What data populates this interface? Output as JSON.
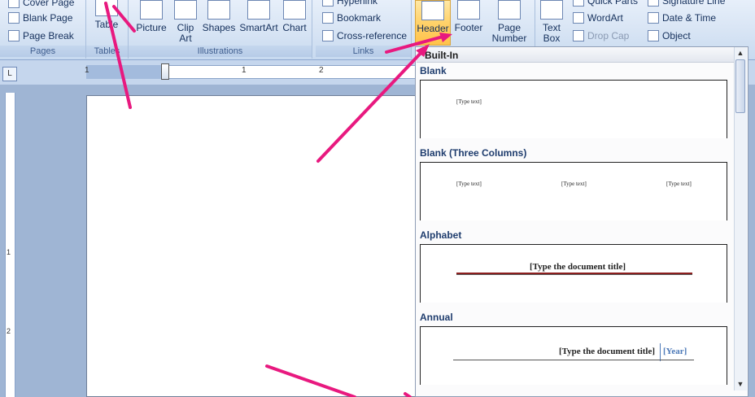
{
  "ribbon": {
    "pages_group": {
      "label": "Pages",
      "cover_page": "Cover Page",
      "blank_page": "Blank Page",
      "page_break": "Page Break"
    },
    "tables_group": {
      "label": "Tables",
      "table": "Table"
    },
    "illustrations_group": {
      "label": "Illustrations",
      "picture": "Picture",
      "clip_art": "Clip Art",
      "shapes": "Shapes",
      "smartart": "SmartArt",
      "chart": "Chart"
    },
    "links_group": {
      "label": "Links",
      "hyperlink": "Hyperlink",
      "bookmark": "Bookmark",
      "cross_reference": "Cross-reference"
    },
    "header_footer_group": {
      "header": "Header",
      "footer": "Footer",
      "page_number": "Page Number"
    },
    "text_group": {
      "text_box": "Text Box",
      "quick_parts": "Quick Parts",
      "wordart": "WordArt",
      "drop_cap": "Drop Cap",
      "signature_line": "Signature Line",
      "date_time": "Date & Time",
      "object": "Object"
    }
  },
  "ruler": {
    "numbers": [
      "1",
      "1",
      "2"
    ]
  },
  "vertical_ruler": {
    "numbers": [
      "1",
      "2"
    ]
  },
  "gallery": {
    "section_label": "Built-In",
    "items": [
      {
        "title": "Blank",
        "placeholders": [
          "[Type text]"
        ]
      },
      {
        "title": "Blank (Three Columns)",
        "placeholders": [
          "[Type text]",
          "[Type text]",
          "[Type text]"
        ]
      },
      {
        "title": "Alphabet",
        "doc_title": "[Type the document title]"
      },
      {
        "title": "Annual",
        "doc_title": "[Type the document title]",
        "year": "[Year]"
      }
    ]
  },
  "colors": {
    "ribbon_bg": "#d7e4f4",
    "active_button": "#ffd26a",
    "annotation_arrow": "#e8197f",
    "year_text": "#4c79b8"
  }
}
